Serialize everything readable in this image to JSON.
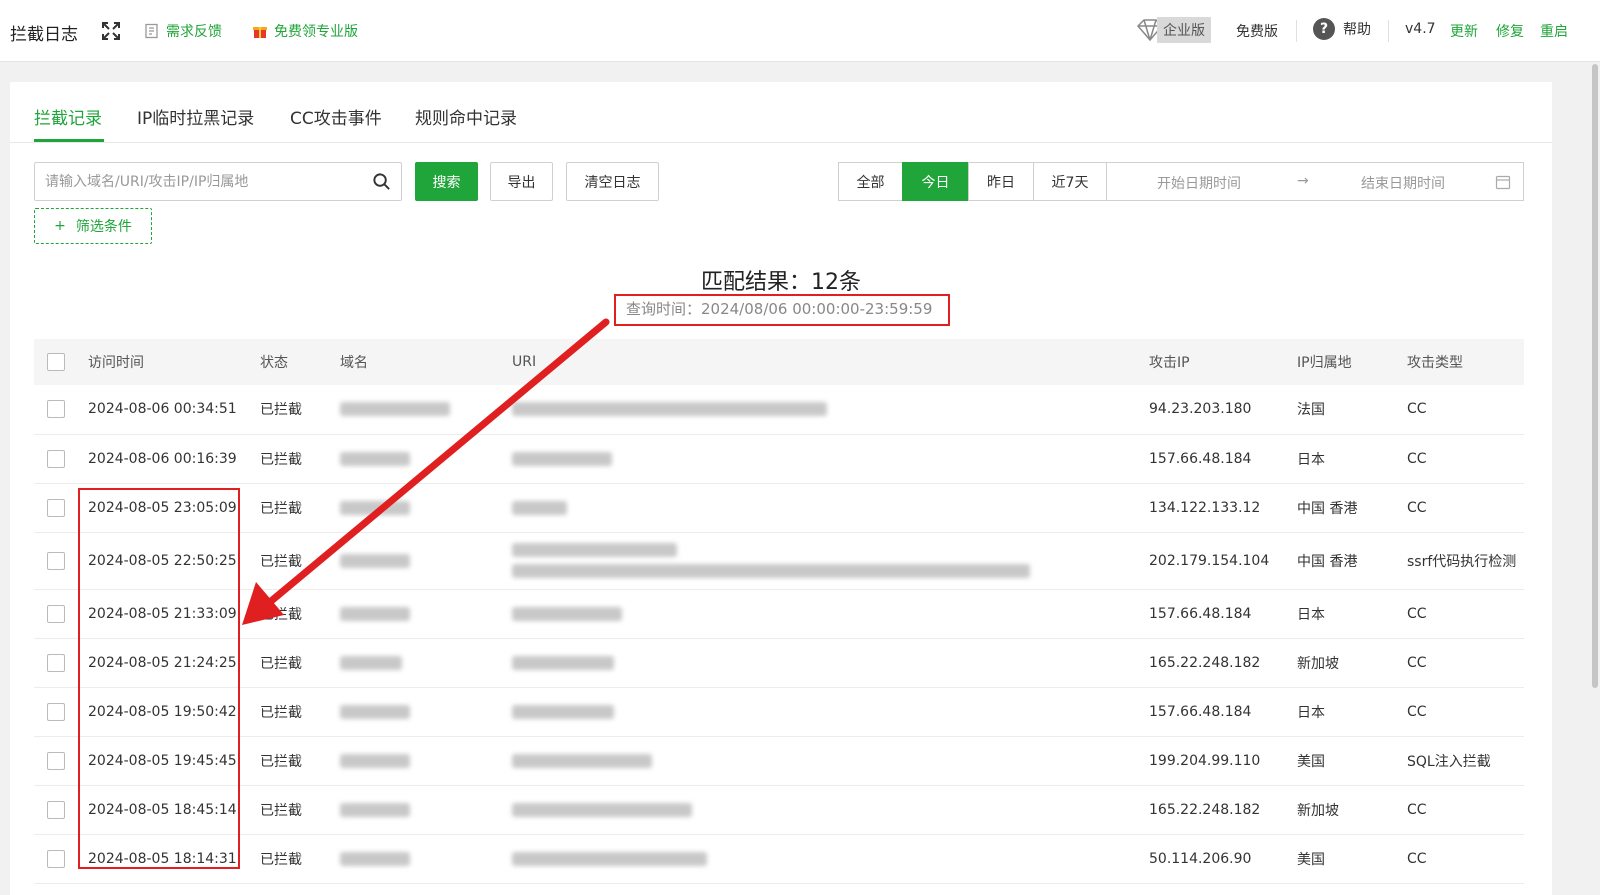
{
  "header": {
    "title": "拦截日志",
    "feedback": "需求反馈",
    "free_pro": "免费领专业版",
    "enterprise": "企业版",
    "free_edition": "免费版",
    "help": "帮助",
    "version": "v4.7",
    "update": "更新",
    "repair": "修复",
    "restart": "重启"
  },
  "tabs": [
    "拦截记录",
    "IP临时拉黑记录",
    "CC攻击事件",
    "规则命中记录"
  ],
  "toolbar": {
    "search_placeholder": "请输入域名/URI/攻击IP/IP归属地",
    "search_button": "搜索",
    "export": "导出",
    "clear_log": "清空日志",
    "filter": "筛选条件",
    "ranges": [
      "全部",
      "今日",
      "昨日",
      "近7天"
    ],
    "start_placeholder": "开始日期时间",
    "end_placeholder": "结束日期时间"
  },
  "summary": {
    "match": "匹配结果：12条",
    "query_time": "查询时间：2024/08/06 00:00:00-23:59:59"
  },
  "table": {
    "headers": [
      "访问时间",
      "状态",
      "域名",
      "URI",
      "攻击IP",
      "IP归属地",
      "攻击类型"
    ],
    "rows": [
      {
        "time": "2024-08-06 00:34:51",
        "status": "已拦截",
        "ip": "94.23.203.180",
        "region": "法国",
        "type": "CC"
      },
      {
        "time": "2024-08-06 00:16:39",
        "status": "已拦截",
        "ip": "157.66.48.184",
        "region": "日本",
        "type": "CC"
      },
      {
        "time": "2024-08-05 23:05:09",
        "status": "已拦截",
        "ip": "134.122.133.12",
        "region": "中国 香港",
        "type": "CC"
      },
      {
        "time": "2024-08-05 22:50:25",
        "status": "已拦截",
        "ip": "202.179.154.104",
        "region": "中国 香港",
        "type": "ssrf代码执行检测"
      },
      {
        "time": "2024-08-05 21:33:09",
        "status": "已拦截",
        "ip": "157.66.48.184",
        "region": "日本",
        "type": "CC"
      },
      {
        "time": "2024-08-05 21:24:25",
        "status": "已拦截",
        "ip": "165.22.248.182",
        "region": "新加坡",
        "type": "CC"
      },
      {
        "time": "2024-08-05 19:50:42",
        "status": "已拦截",
        "ip": "157.66.48.184",
        "region": "日本",
        "type": "CC"
      },
      {
        "time": "2024-08-05 19:45:45",
        "status": "已拦截",
        "ip": "199.204.99.110",
        "region": "美国",
        "type": "SQL注入拦截"
      },
      {
        "time": "2024-08-05 18:45:14",
        "status": "已拦截",
        "ip": "165.22.248.182",
        "region": "新加坡",
        "type": "CC"
      },
      {
        "time": "2024-08-05 18:14:31",
        "status": "已拦截",
        "ip": "50.114.206.90",
        "region": "美国",
        "type": "CC"
      }
    ]
  },
  "colors": {
    "accent": "#20a53a",
    "danger": "#e02020"
  }
}
